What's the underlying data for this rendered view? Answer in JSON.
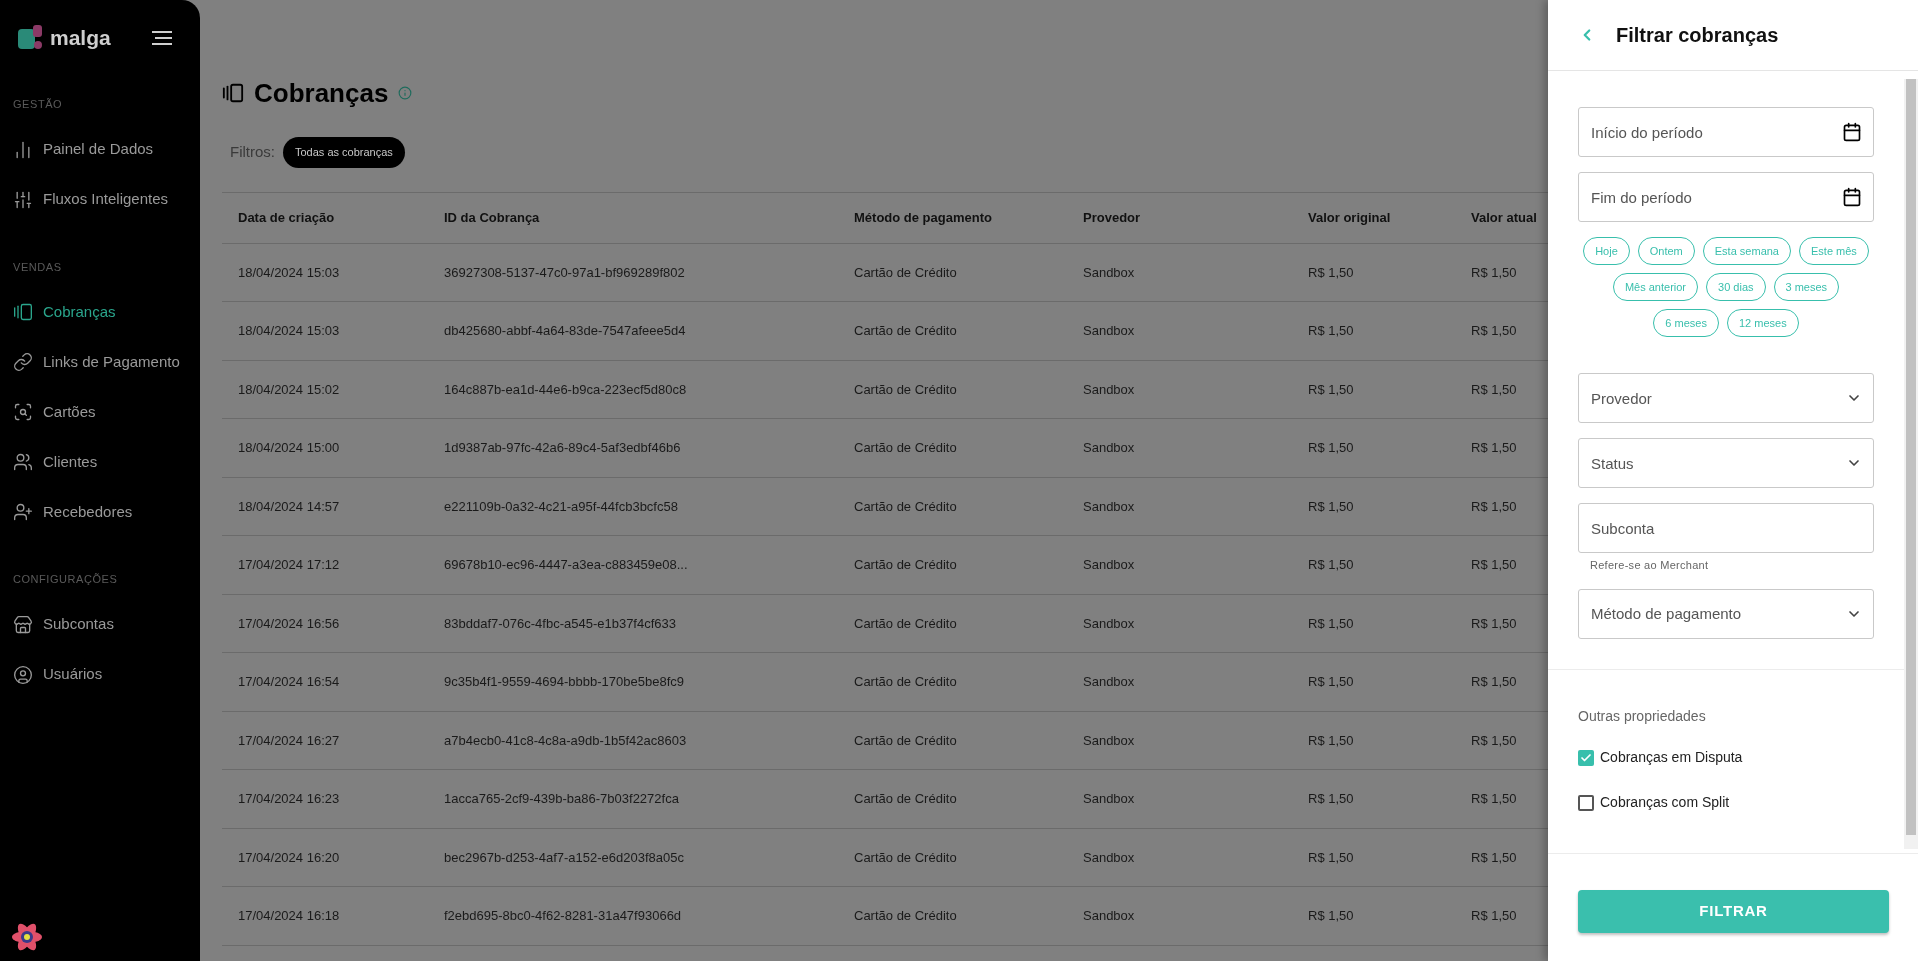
{
  "sidebar": {
    "logo": "malga",
    "sections": [
      {
        "title": "GESTÃO",
        "items": [
          {
            "label": "Painel de Dados",
            "selected": false
          },
          {
            "label": "Fluxos Inteligentes",
            "selected": false
          }
        ]
      },
      {
        "title": "VENDAS",
        "items": [
          {
            "label": "Cobranças",
            "selected": true
          },
          {
            "label": "Links de Pagamento",
            "selected": false
          },
          {
            "label": "Cartões",
            "selected": false
          },
          {
            "label": "Clientes",
            "selected": false
          },
          {
            "label": "Recebedores",
            "selected": false
          }
        ]
      },
      {
        "title": "CONFIGURAÇÕES",
        "items": [
          {
            "label": "Subcontas",
            "selected": false
          },
          {
            "label": "Usuários",
            "selected": false
          }
        ]
      }
    ]
  },
  "page": {
    "title": "Cobranças",
    "filters_label": "Filtros:",
    "filter_chip": "Todas as cobranças"
  },
  "table": {
    "columns": [
      "Data de criação",
      "ID da Cobrança",
      "Método de pagamento",
      "Provedor",
      "Valor original",
      "Valor atual"
    ],
    "rows": [
      [
        "18/04/2024 15:03",
        "36927308-5137-47c0-97a1-bf969289f802",
        "Cartão de Crédito",
        "Sandbox",
        "R$ 1,50",
        "R$ 1,50"
      ],
      [
        "18/04/2024 15:03",
        "db425680-abbf-4a64-83de-7547afeee5d4",
        "Cartão de Crédito",
        "Sandbox",
        "R$ 1,50",
        "R$ 1,50"
      ],
      [
        "18/04/2024 15:02",
        "164c887b-ea1d-44e6-b9ca-223ecf5d80c8",
        "Cartão de Crédito",
        "Sandbox",
        "R$ 1,50",
        "R$ 1,50"
      ],
      [
        "18/04/2024 15:00",
        "1d9387ab-97fc-42a6-89c4-5af3edbf46b6",
        "Cartão de Crédito",
        "Sandbox",
        "R$ 1,50",
        "R$ 1,50"
      ],
      [
        "18/04/2024 14:57",
        "e221109b-0a32-4c21-a95f-44fcb3bcfc58",
        "Cartão de Crédito",
        "Sandbox",
        "R$ 1,50",
        "R$ 1,50"
      ],
      [
        "17/04/2024 17:12",
        "69678b10-ec96-4447-a3ea-c883459e08...",
        "Cartão de Crédito",
        "Sandbox",
        "R$ 1,50",
        "R$ 1,50"
      ],
      [
        "17/04/2024 16:56",
        "83bddaf7-076c-4fbc-a545-e1b37f4cf633",
        "Cartão de Crédito",
        "Sandbox",
        "R$ 1,50",
        "R$ 1,50"
      ],
      [
        "17/04/2024 16:54",
        "9c35b4f1-9559-4694-bbbb-170be5be8fc9",
        "Cartão de Crédito",
        "Sandbox",
        "R$ 1,50",
        "R$ 1,50"
      ],
      [
        "17/04/2024 16:27",
        "a7b4ecb0-41c8-4c8a-a9db-1b5f42ac8603",
        "Cartão de Crédito",
        "Sandbox",
        "R$ 1,50",
        "R$ 1,50"
      ],
      [
        "17/04/2024 16:23",
        "1acca765-2cf9-439b-ba86-7b03f2272fca",
        "Cartão de Crédito",
        "Sandbox",
        "R$ 1,50",
        "R$ 1,50"
      ],
      [
        "17/04/2024 16:20",
        "bec2967b-d253-4af7-a152-e6d203f8a05c",
        "Cartão de Crédito",
        "Sandbox",
        "R$ 1,50",
        "R$ 1,50"
      ],
      [
        "17/04/2024 16:18",
        "f2ebd695-8bc0-4f62-8281-31a47f93066d",
        "Cartão de Crédito",
        "Sandbox",
        "R$ 1,50",
        "R$ 1,50"
      ]
    ]
  },
  "drawer": {
    "title": "Filtrar cobranças",
    "date_fields": [
      {
        "placeholder": "Início do período"
      },
      {
        "placeholder": "Fim do período"
      }
    ],
    "quick_ranges": [
      [
        "Hoje",
        "Ontem",
        "Esta semana",
        "Este mês"
      ],
      [
        "Mês anterior",
        "30 dias",
        "3 meses"
      ],
      [
        "6 meses",
        "12 meses"
      ]
    ],
    "fields": [
      {
        "kind": "select",
        "placeholder": "Provedor"
      },
      {
        "kind": "select",
        "placeholder": "Status"
      },
      {
        "kind": "text",
        "placeholder": "Subconta",
        "hint": "Refere-se ao Merchant"
      },
      {
        "kind": "select",
        "placeholder": "Método de pagamento"
      }
    ],
    "other_title": "Outras propriedades",
    "options": [
      {
        "label": "Cobranças em Disputa",
        "checked": true
      },
      {
        "label": "Cobranças com Split",
        "checked": false
      }
    ],
    "submit": "FILTRAR"
  }
}
